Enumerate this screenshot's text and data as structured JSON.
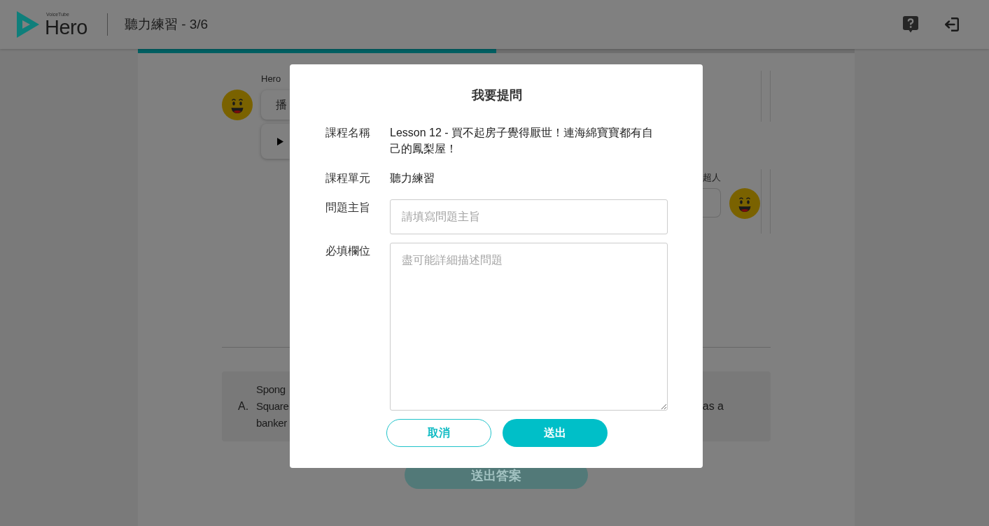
{
  "header": {
    "logo": {
      "tagline": "VoiceTube",
      "name": "Hero"
    },
    "title": "聽力練習 - 3/6"
  },
  "progress": {
    "level": 0.5
  },
  "chat": [
    {
      "kind": "incoming",
      "sender": "Hero",
      "bubbles": [
        {
          "kind": "text",
          "text": "播"
        },
        {
          "kind": "audio"
        }
      ]
    },
    {
      "kind": "outgoing",
      "sender": "超人",
      "bubbles": [
        {
          "kind": "blank"
        }
      ]
    }
  ],
  "answer": {
    "options": [
      {
        "letter": "A.",
        "lines": [
          "Spong",
          "Square",
          "banker"
        ],
        "line_end": "as a"
      }
    ],
    "submit_button": {
      "label": "送出答案",
      "disabled": true
    }
  },
  "dialog": {
    "title": "我要提問",
    "fields": [
      {
        "kind": "text",
        "label": "課程名稱",
        "value": "Lesson 12 - 買不起房子覺得厭世！連海綿寶寶都有自己的鳳梨屋！"
      },
      {
        "kind": "text",
        "label": "課程單元",
        "value": "聽力練習"
      },
      {
        "kind": "input",
        "label": "問題主旨",
        "placeholder": "請填寫問題主旨"
      },
      {
        "kind": "textarea",
        "label": "必填欄位",
        "placeholder": "盡可能詳細描述問題"
      }
    ],
    "buttons": [
      {
        "kind": "secondary",
        "label": "取消"
      },
      {
        "kind": "primary",
        "label": "送出"
      }
    ]
  }
}
